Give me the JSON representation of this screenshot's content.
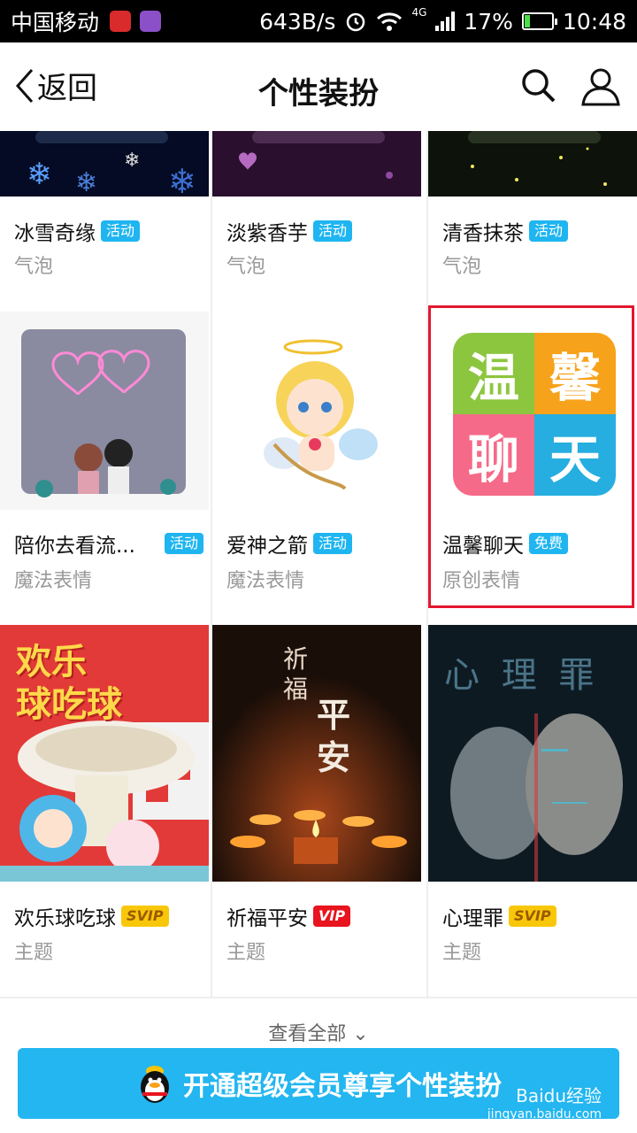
{
  "status_bar": {
    "carrier": "中国移动",
    "speed": "643B/s",
    "network": "4G",
    "battery": "17%",
    "time": "10:48"
  },
  "nav": {
    "back_label": "返回",
    "title": "个性装扮"
  },
  "items": [
    {
      "name": "冰雪奇缘",
      "badge": "活动",
      "category": "气泡"
    },
    {
      "name": "淡紫香芋",
      "badge": "活动",
      "category": "气泡"
    },
    {
      "name": "清香抹茶",
      "badge": "活动",
      "category": "气泡"
    },
    {
      "name": "陪你去看流...",
      "badge": "活动",
      "category": "魔法表情"
    },
    {
      "name": "爱神之箭",
      "badge": "活动",
      "category": "魔法表情"
    },
    {
      "name": "温馨聊天",
      "badge": "免费",
      "category": "原创表情",
      "tiles": [
        "温",
        "馨",
        "聊",
        "天"
      ]
    },
    {
      "name": "欢乐球吃球",
      "badge": "SVIP",
      "category": "主题",
      "art_text": [
        "欢乐",
        "球吃球"
      ]
    },
    {
      "name": "祈福平安",
      "badge": "VIP",
      "category": "主题",
      "art_text": [
        "祈",
        "福",
        "平",
        "安"
      ]
    },
    {
      "name": "心理罪",
      "badge": "SVIP",
      "category": "主题",
      "art_text": "心 理 罪"
    }
  ],
  "see_all": "查看全部",
  "vip_banner": "开通超级会员尊享个性装扮",
  "watermark": {
    "brand": "Baidu经验",
    "url": "jingyan.baidu.com"
  },
  "colors": {
    "accent": "#23b6f0",
    "highlight": "#e3172f",
    "badge_blue": "#1eb5f0",
    "vip_red": "#e8141e",
    "svip_yellow": "#f9c70a"
  }
}
